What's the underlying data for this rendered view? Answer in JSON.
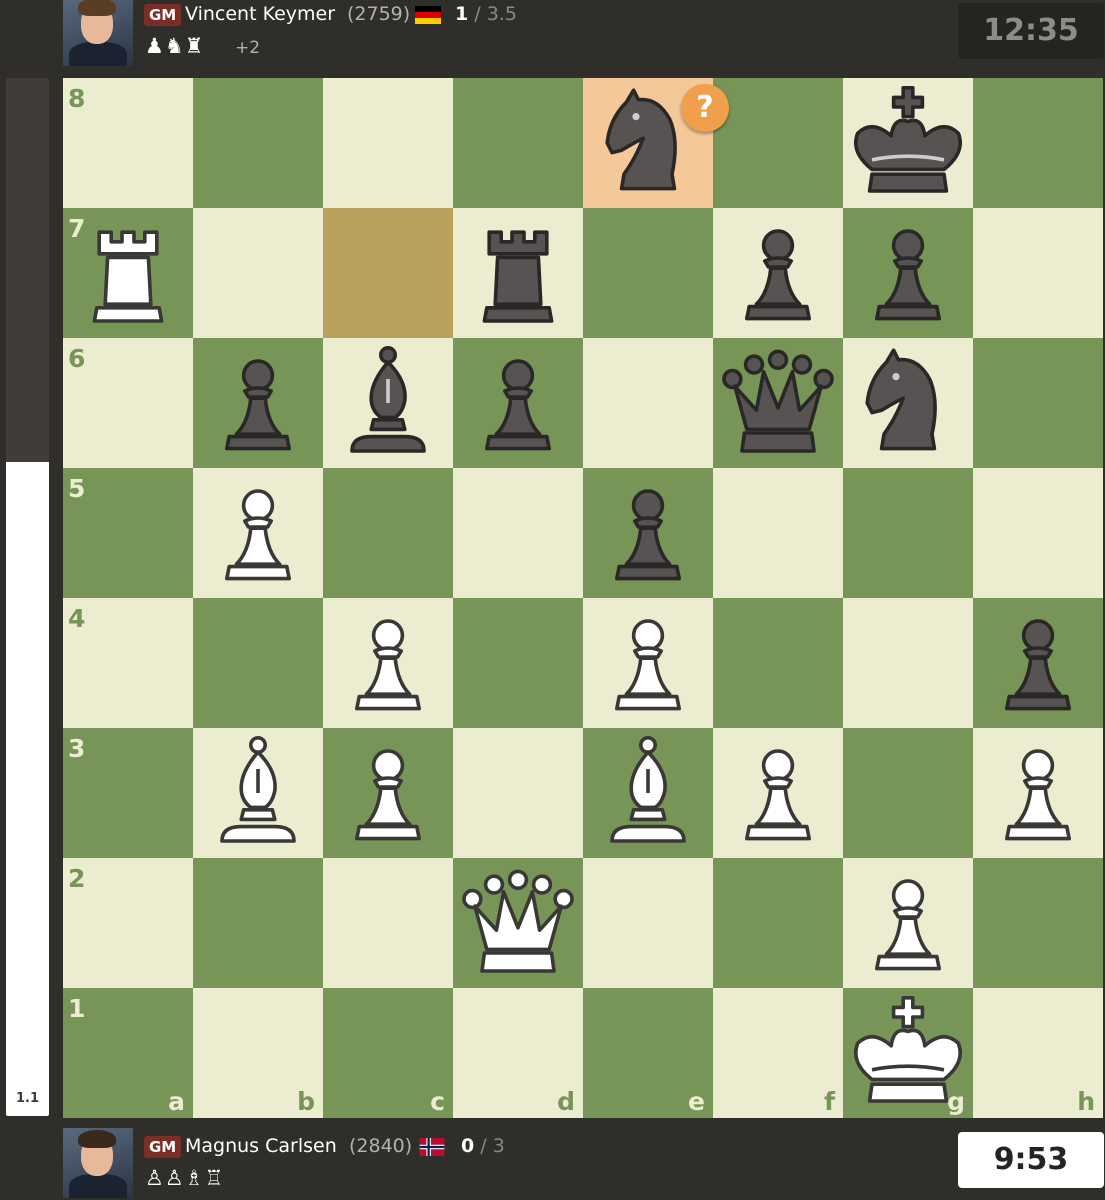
{
  "top_player": {
    "title": "GM",
    "name": "Vincent Keymer",
    "rating": "(2759)",
    "flag": "germany",
    "score_won": "1",
    "score_total": " / 3.5",
    "captured": "♟♞♜",
    "advantage": "+2",
    "clock": "12:35"
  },
  "bottom_player": {
    "title": "GM",
    "name": "Magnus Carlsen",
    "rating": "(2840)",
    "flag": "norway",
    "score_won": "0",
    "score_total": " / 3",
    "captured": "♙♙♗♖",
    "clock": "9:53"
  },
  "evaluation": {
    "label": "1.1",
    "white_fraction": 0.63
  },
  "board": {
    "files": [
      "a",
      "b",
      "c",
      "d",
      "e",
      "f",
      "g",
      "h"
    ],
    "ranks": [
      "8",
      "7",
      "6",
      "5",
      "4",
      "3",
      "2",
      "1"
    ],
    "pieces": [
      {
        "square": "e8",
        "color": "black",
        "type": "knight"
      },
      {
        "square": "g8",
        "color": "black",
        "type": "king"
      },
      {
        "square": "a7",
        "color": "white",
        "type": "rook"
      },
      {
        "square": "d7",
        "color": "black",
        "type": "rook"
      },
      {
        "square": "f7",
        "color": "black",
        "type": "pawn"
      },
      {
        "square": "g7",
        "color": "black",
        "type": "pawn"
      },
      {
        "square": "b6",
        "color": "black",
        "type": "pawn"
      },
      {
        "square": "c6",
        "color": "black",
        "type": "bishop"
      },
      {
        "square": "d6",
        "color": "black",
        "type": "pawn"
      },
      {
        "square": "f6",
        "color": "black",
        "type": "queen"
      },
      {
        "square": "g6",
        "color": "black",
        "type": "knight"
      },
      {
        "square": "b5",
        "color": "white",
        "type": "pawn"
      },
      {
        "square": "e5",
        "color": "black",
        "type": "pawn"
      },
      {
        "square": "c4",
        "color": "white",
        "type": "pawn"
      },
      {
        "square": "e4",
        "color": "white",
        "type": "pawn"
      },
      {
        "square": "h4",
        "color": "black",
        "type": "pawn"
      },
      {
        "square": "b3",
        "color": "white",
        "type": "bishop"
      },
      {
        "square": "c3",
        "color": "white",
        "type": "pawn"
      },
      {
        "square": "e3",
        "color": "white",
        "type": "bishop"
      },
      {
        "square": "f3",
        "color": "white",
        "type": "pawn"
      },
      {
        "square": "h3",
        "color": "white",
        "type": "pawn"
      },
      {
        "square": "d2",
        "color": "white",
        "type": "queen"
      },
      {
        "square": "g2",
        "color": "white",
        "type": "pawn"
      },
      {
        "square": "g1",
        "color": "white",
        "type": "king"
      }
    ],
    "last_move_from": "c7",
    "last_move_to": "e8",
    "annotation": {
      "square": "e8",
      "symbol": "?"
    },
    "colors": {
      "light": "#ebecd0",
      "dark": "#779556",
      "move_from": "#b9a15c",
      "move_to": "#f5c89a",
      "badge": "#f0a04b"
    }
  }
}
